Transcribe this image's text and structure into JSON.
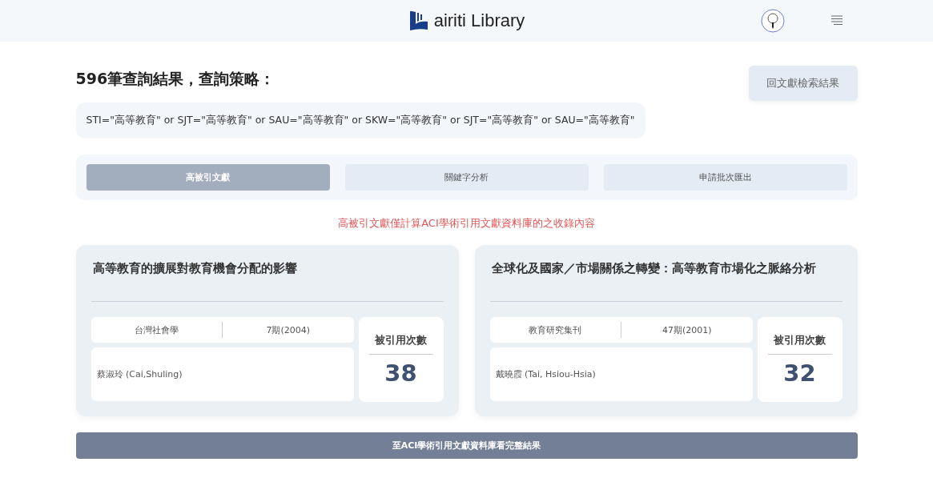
{
  "header": {
    "logo_text": "airiti Library"
  },
  "heading": "596筆查詢結果，查詢策略：",
  "back_button": "回文獻檢索結果",
  "query": "STI=\"高等教育\" or SJT=\"高等教育\" or SAU=\"高等教育\" or SKW=\"高等教育\" or SJT=\"高等教育\" or SAU=\"高等教育\"",
  "tabs": [
    {
      "label": "高被引文獻",
      "selected": true
    },
    {
      "label": "關鍵字分析",
      "selected": false
    },
    {
      "label": "申請批次匯出",
      "selected": false
    }
  ],
  "notice": "高被引文獻僅計算ACI學術引用文獻資料庫的之收錄內容",
  "papers": [
    {
      "title": "高等教育的擴展對教育機會分配的影響",
      "journal": "台灣社會學",
      "issue": "7期(2004)",
      "author": "蔡淑玲 (Cai,Shuling)",
      "citation_label": "被引用次數",
      "citations": "38"
    },
    {
      "title": "全球化及國家／市場關係之轉變：高等教育市場化之脈絡分析",
      "journal": "教育研究集刊",
      "issue": "47期(2001)",
      "author": "戴曉霞 (Tai, Hsiou-Hsia)",
      "citation_label": "被引用次數",
      "citations": "32"
    }
  ],
  "footer_button": "至ACI學術引用文獻資料庫看完整結果"
}
